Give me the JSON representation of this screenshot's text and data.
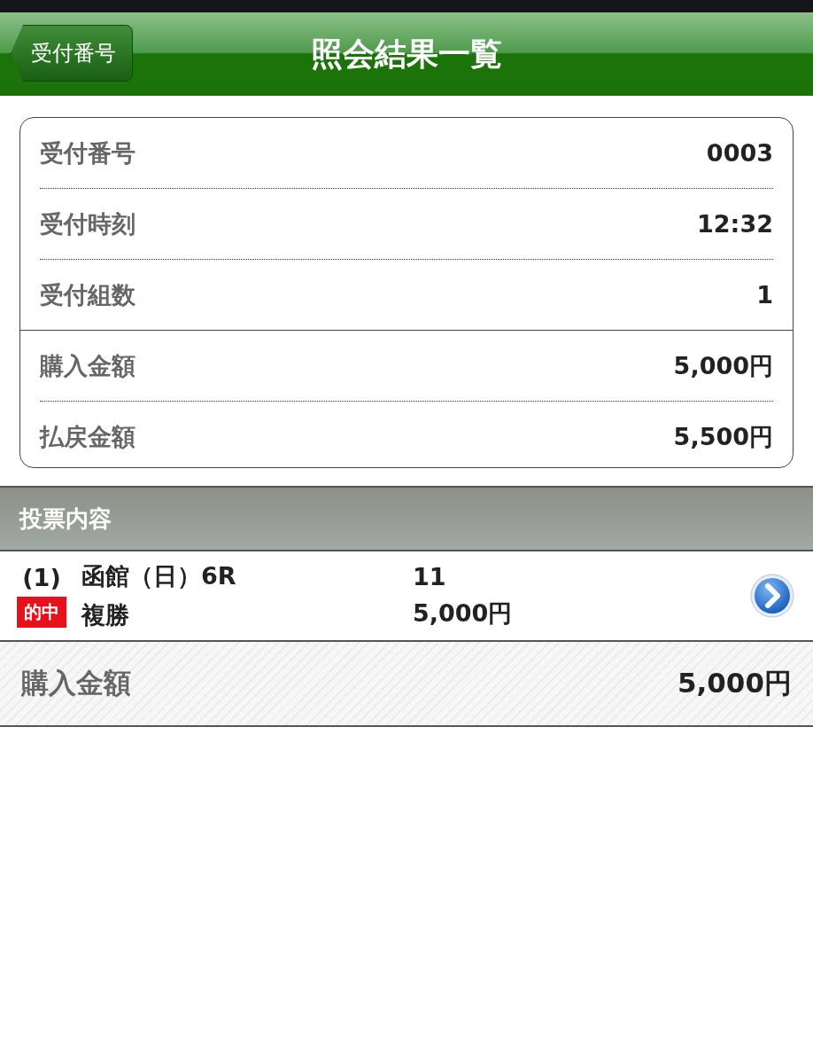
{
  "header": {
    "back_button": "受付番号",
    "title": "照会結果一覧"
  },
  "summary": {
    "groups": [
      [
        {
          "label": "受付番号",
          "value": "0003"
        },
        {
          "label": "受付時刻",
          "value": "12:32"
        },
        {
          "label": "受付組数",
          "value": "1"
        }
      ],
      [
        {
          "label": "購入金額",
          "value": "5,000円"
        },
        {
          "label": "払戻金額",
          "value": "5,500円"
        }
      ]
    ]
  },
  "section": {
    "title": "投票内容"
  },
  "bets": [
    {
      "number": "(1)",
      "badge": "的中",
      "venue": "函館（日）6R",
      "type": "複勝",
      "selection": "11",
      "amount": "5,000円"
    }
  ],
  "total": {
    "label": "購入金額",
    "value": "5,000円"
  }
}
